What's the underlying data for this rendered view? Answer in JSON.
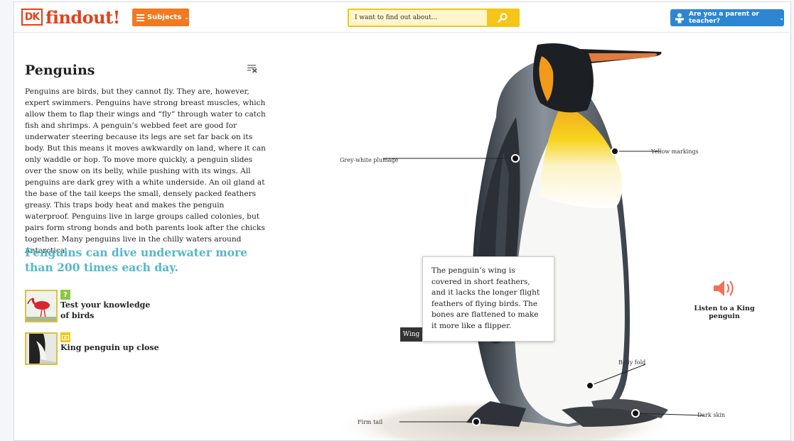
{
  "header": {
    "logo_dk": "DK",
    "logo_text_a": "find",
    "logo_text_b": "out!",
    "subjects_label": "Subjects",
    "search_placeholder": "I want to find out about...",
    "parent_label": "Are you a parent or teacher?"
  },
  "article": {
    "title": "Penguins",
    "body": "Penguins are birds, but they cannot fly. They are, however, expert swimmers. Penguins have strong breast muscles, which allow them to flap their wings and “fly” through water to catch fish and shrimps. A penguin’s webbed feet are good for underwater steering because its legs are set far back on its body. But this means it moves awkwardly on land, where it can only waddle or hop. To move more quickly, a penguin slides over the snow on its belly, while pushing with its wings. All penguins are dark grey with a white underside. An oil gland at the base of the tail keeps the small, densely packed feathers greasy. This traps body heat and makes the penguin waterproof. Penguins live in large groups called colonies, but pairs form strong bonds and both parents look after the chicks together. Many penguins live in the chilly waters around Antarctica.",
    "fact": "Penguins can dive underwater more than 200 times each day."
  },
  "related": [
    {
      "label": "Test your knowledge of birds",
      "badge": "?",
      "icon": "quiz-icon"
    },
    {
      "label": "King penguin up close",
      "badge": "",
      "icon": "photo-icon"
    }
  ],
  "hotspots": {
    "grey_white": "Grey-white plumage",
    "yellow": "Yellow markings",
    "belly": "Belly fold",
    "dark_skin": "Dark skin",
    "firm_tail": "Firm tail",
    "wing": "Wing"
  },
  "tooltip": {
    "text": "The penguin’s wing is covered in short feathers, and it lacks the longer flight feathers of flying birds. The bones are flattened to make it more like a flipper."
  },
  "audio": {
    "label": "Listen to a King penguin",
    "icon": "speaker-icon"
  },
  "colors": {
    "brand": "#e2411c",
    "subjects": "#f07a22",
    "search": "#f5c518",
    "parent": "#2e86d3",
    "fact": "#54b8c8",
    "audio": "#f0705a"
  }
}
